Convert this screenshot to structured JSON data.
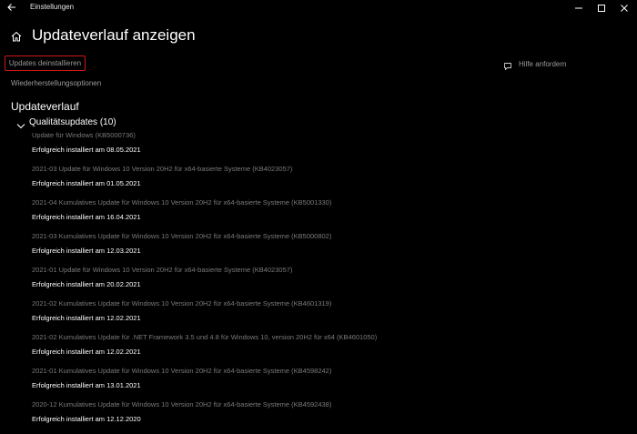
{
  "window": {
    "app_title": "Einstellungen"
  },
  "header": {
    "page_title": "Updateverlauf anzeigen"
  },
  "links": {
    "uninstall": "Updates deinstallieren",
    "recovery": "Wiederherstellungsoptionen",
    "help": "Hilfe anfordern"
  },
  "section": {
    "title": "Updateverlauf"
  },
  "group": {
    "label": "Qualitätsupdates (10)"
  },
  "updates": [
    {
      "name": "Update für Windows (KB5000736)",
      "status": "Erfolgreich installiert am 08.05.2021"
    },
    {
      "name": "2021-03 Update für Windows 10 Version 20H2 für x64-basierte Systeme (KB4023057)",
      "status": "Erfolgreich installiert am 01.05.2021"
    },
    {
      "name": "2021-04 Kumulatives Update für Windows 10 Version 20H2 für x64-basierte Systeme (KB5001330)",
      "status": "Erfolgreich installiert am 16.04.2021"
    },
    {
      "name": "2021-03 Kumulatives Update für Windows 10 Version 20H2 für x64-basierte Systeme (KB5000802)",
      "status": "Erfolgreich installiert am 12.03.2021"
    },
    {
      "name": "2021-01 Update für Windows 10 Version 20H2 für x64-basierte Systeme (KB4023057)",
      "status": "Erfolgreich installiert am 20.02.2021"
    },
    {
      "name": "2021-02 Kumulatives Update für Windows 10 Version 20H2 für x64-basierte Systeme (KB4601319)",
      "status": "Erfolgreich installiert am 12.02.2021"
    },
    {
      "name": "2021-02 Kumulatives Update für .NET Framework 3.5 und 4.8 für Windows 10, version 20H2 für x64 (KB4601050)",
      "status": "Erfolgreich installiert am 12.02.2021"
    },
    {
      "name": "2021-01 Kumulatives Update für Windows 10 Version 20H2 für x64-basierte Systeme (KB4598242)",
      "status": "Erfolgreich installiert am 13.01.2021"
    },
    {
      "name": "2020-12 Kumulatives Update für Windows 10 Version 20H2 für x64-basierte Systeme (KB4592438)",
      "status": "Erfolgreich installiert am 12.12.2020"
    }
  ],
  "colors": {
    "background": "#000000",
    "text_primary": "#ffffff",
    "text_secondary": "#9a9a9a",
    "text_dim": "#7a7a7a",
    "highlight_border": "#d01717"
  }
}
